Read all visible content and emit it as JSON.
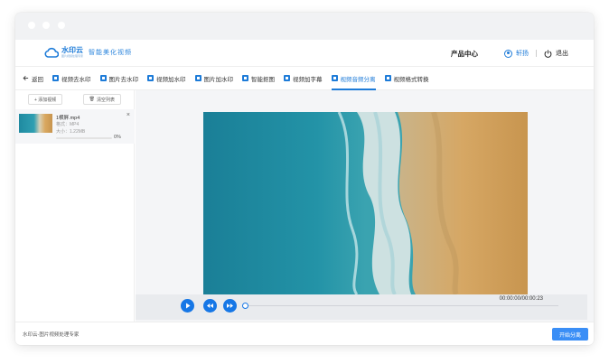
{
  "logo": {
    "name": "水印云",
    "sub": "图片视频处理专家",
    "slogan": "智能美化视频"
  },
  "header": {
    "product_center": "产品中心",
    "user_name": "轩扬",
    "logout": "退出"
  },
  "toolbar": {
    "back": "返回",
    "items": [
      "视频去水印",
      "图片去水印",
      "视频加水印",
      "图片加水印",
      "智能抠图",
      "视频加字幕",
      "视频音频分离",
      "视频格式转换"
    ],
    "active_index": 6
  },
  "sidebar": {
    "add_video": "+ 添加视频",
    "clear_list": "清空列表",
    "file": {
      "name": "1横屏.mp4",
      "format": "格式：MP4",
      "size": "大小：1.22MB",
      "progress_text": "0%",
      "progress": 0
    }
  },
  "player": {
    "time": "00:00:00/00:00:23"
  },
  "footer": {
    "text": "水印云-图片视频处理专家",
    "start_button": "开始分离"
  },
  "colors": {
    "accent": "#1d7bd8",
    "button": "#3a8ef6"
  }
}
